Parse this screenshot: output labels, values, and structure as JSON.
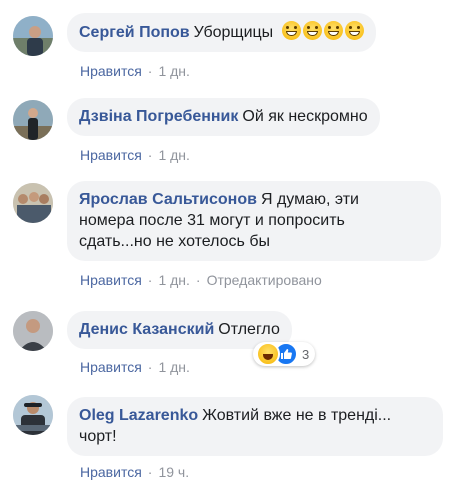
{
  "comments": [
    {
      "author": "Сергей Попов",
      "text": "Уборщицы",
      "like": "Нравится",
      "time": "1 дн.",
      "emoji_count": 4
    },
    {
      "author": "Дзвіна Погребенник",
      "text": "Ой як нескромно",
      "like": "Нравится",
      "time": "1 дн."
    },
    {
      "author": "Ярослав Сальтисонов",
      "text_lines": [
        "Я думаю, эти",
        "номера после 31 могут и попросить",
        "сдать...но не хотелось бы"
      ],
      "like": "Нравится",
      "time": "1 дн.",
      "edited": "Отредактировано"
    },
    {
      "author": "Денис Казанский",
      "text": "Отлегло",
      "like": "Нравится",
      "time": "1 дн.",
      "reactions": {
        "types": [
          "haha",
          "like"
        ],
        "count": "3"
      }
    },
    {
      "author": "Oleg Lazarenko",
      "text_lines": [
        "Жовтий вже не в тренді...",
        "чорт!"
      ],
      "like": "Нравится",
      "time": "19 ч."
    }
  ],
  "separator": "·",
  "colors": {
    "author": "#385898",
    "bubble": "#f2f3f5",
    "meta": "#90949c",
    "like_link": "#4b67a1"
  }
}
